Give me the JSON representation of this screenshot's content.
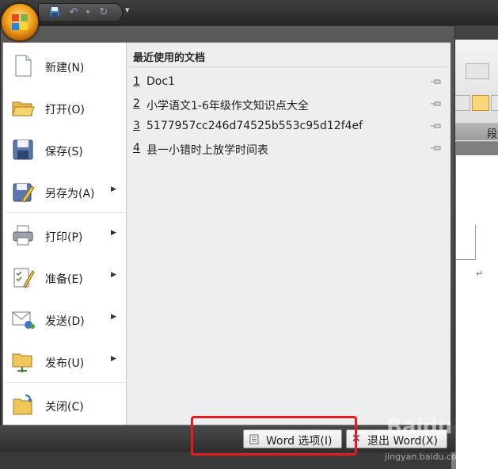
{
  "quick_access": {
    "more_glyph": "▾"
  },
  "ribbon": {
    "group_label": "段"
  },
  "menu": {
    "items": [
      {
        "label": "新建(N)",
        "icon": "new-document-icon",
        "has_arrow": false
      },
      {
        "label": "打开(O)",
        "icon": "open-folder-icon",
        "has_arrow": false
      },
      {
        "label": "保存(S)",
        "icon": "save-disk-icon",
        "has_arrow": false
      },
      {
        "label": "另存为(A)",
        "icon": "save-as-icon",
        "has_arrow": true
      },
      {
        "label": "打印(P)",
        "icon": "printer-icon",
        "has_arrow": true
      },
      {
        "label": "准备(E)",
        "icon": "prepare-icon",
        "has_arrow": true
      },
      {
        "label": "发送(D)",
        "icon": "send-icon",
        "has_arrow": true
      },
      {
        "label": "发布(U)",
        "icon": "publish-icon",
        "has_arrow": true
      },
      {
        "label": "关闭(C)",
        "icon": "close-folder-icon",
        "has_arrow": false
      }
    ],
    "arrow_glyph": "▶"
  },
  "recent": {
    "title": "最近使用的文档",
    "documents": [
      {
        "num": "1",
        "name": "Doc1"
      },
      {
        "num": "2",
        "name": "小学语文1-6年级作文知识点大全"
      },
      {
        "num": "3",
        "name": "5177957cc246d74525b553c95d12f4ef"
      },
      {
        "num": "4",
        "name": "县一小错时上放学时间表"
      }
    ]
  },
  "footer": {
    "options_label": "Word 选项(I)",
    "exit_label": "退出 Word(X)"
  },
  "paragraph_mark": "↵",
  "watermark": {
    "line1": "Baidu",
    "line2": "jingyan.baidu.com"
  },
  "colors": {
    "highlight": "#e8191c",
    "office_orange": "#f2a21b"
  }
}
